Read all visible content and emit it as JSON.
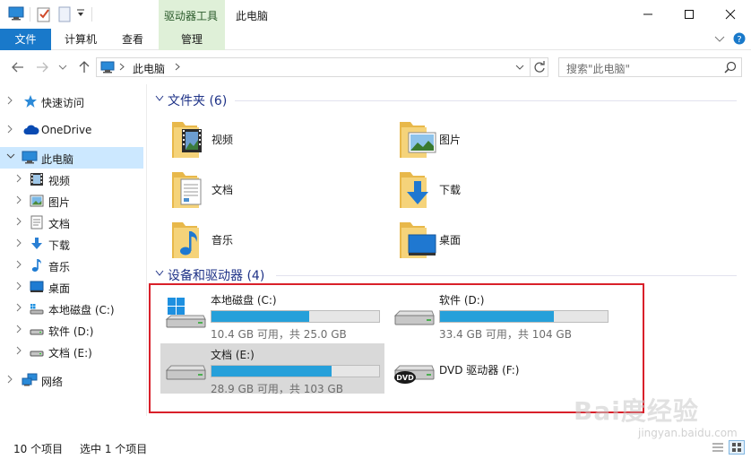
{
  "window": {
    "title": "此电脑",
    "context_group": "驱动器工具",
    "controls": [
      "minimize-icon",
      "maximize-icon",
      "close-icon"
    ]
  },
  "ribbon": {
    "tabs": [
      {
        "label": "文件"
      },
      {
        "label": "计算机"
      },
      {
        "label": "查看"
      },
      {
        "label": "管理"
      }
    ]
  },
  "address": {
    "path_segment": "此电脑",
    "search_placeholder": "搜索\"此电脑\""
  },
  "sidebar": {
    "items": [
      {
        "label": "快速访问",
        "icon": "star-icon"
      },
      {
        "label": "OneDrive",
        "icon": "cloud-icon"
      },
      {
        "label": "此电脑",
        "icon": "monitor-icon"
      },
      {
        "label": "视频",
        "icon": "video-icon"
      },
      {
        "label": "图片",
        "icon": "picture-icon"
      },
      {
        "label": "文档",
        "icon": "document-icon"
      },
      {
        "label": "下载",
        "icon": "download-icon"
      },
      {
        "label": "音乐",
        "icon": "music-icon"
      },
      {
        "label": "桌面",
        "icon": "desktop-icon"
      },
      {
        "label": "本地磁盘 (C:)",
        "icon": "drive-icon"
      },
      {
        "label": "软件 (D:)",
        "icon": "drive-icon"
      },
      {
        "label": "文档 (E:)",
        "icon": "drive-icon"
      },
      {
        "label": "网络",
        "icon": "network-icon"
      }
    ]
  },
  "folders_section": {
    "title": "文件夹 (6)",
    "items": [
      {
        "label": "视频",
        "icon": "video-folder-icon"
      },
      {
        "label": "图片",
        "icon": "picture-folder-icon"
      },
      {
        "label": "文档",
        "icon": "document-folder-icon"
      },
      {
        "label": "下载",
        "icon": "download-folder-icon"
      },
      {
        "label": "音乐",
        "icon": "music-folder-icon"
      },
      {
        "label": "桌面",
        "icon": "desktop-folder-icon"
      }
    ]
  },
  "drives_section": {
    "title": "设备和驱动器 (4)",
    "drives": [
      {
        "name": "本地磁盘 (C:)",
        "info": "10.4 GB 可用，共 25.0 GB",
        "used_fraction": 0.584,
        "icon": "windows-drive-icon"
      },
      {
        "name": "软件 (D:)",
        "info": "33.4 GB 可用，共 104 GB",
        "used_fraction": 0.679,
        "icon": "drive-icon"
      },
      {
        "name": "文档 (E:)",
        "info": "28.9 GB 可用，共 103 GB",
        "used_fraction": 0.719,
        "icon": "drive-icon"
      },
      {
        "name": "DVD 驱动器 (F:)",
        "icon": "dvd-drive-icon"
      }
    ]
  },
  "status": {
    "count": "10 个项目",
    "selected": "选中 1 个项目"
  },
  "watermark": {
    "text": "Bai度经验",
    "url": "jingyan.baidu.com"
  },
  "colors": {
    "accent": "#1979ca",
    "selection": "#cce8ff",
    "progress": "#26a0da",
    "context_tab": "#dff0d8",
    "highlight_box": "#d9202a"
  }
}
